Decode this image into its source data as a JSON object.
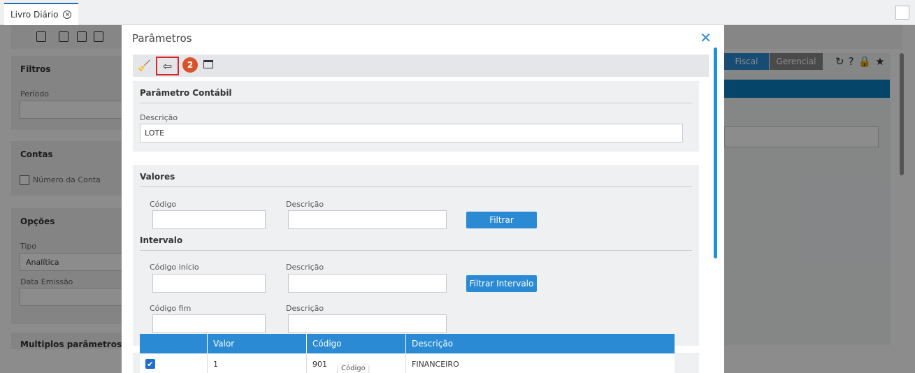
{
  "tab": {
    "label": "Livro Diário"
  },
  "background": {
    "filtros": {
      "title": "Filtros",
      "periodo_label": "Período"
    },
    "contas": {
      "title": "Contas",
      "numero_conta_label": "Número da Conta"
    },
    "opcoes": {
      "title": "Opções",
      "tipo_label": "Tipo",
      "tipo_value": "Analítica",
      "data_emissao_label": "Data Emissão"
    },
    "multiplos": {
      "title": "Multiplos parâmetros"
    },
    "buttons": {
      "fiscal": "Fiscal",
      "gerencial": "Gerencial"
    }
  },
  "modal": {
    "title": "Parâmetros",
    "close": "✕",
    "toolbar": {
      "broom_glyph": "🧹",
      "back_glyph": "⇦",
      "badge": "2"
    },
    "parametro_contabil": {
      "title": "Parâmetro Contábil",
      "descricao_label": "Descrição",
      "descricao_value": "LOTE"
    },
    "valores": {
      "title": "Valores",
      "codigo_label": "Código",
      "descricao_label": "Descrição",
      "filtrar_button": "Filtrar"
    },
    "intervalo": {
      "title": "Intervalo",
      "codigo_inicio_label": "Código início",
      "descricao_label": "Descrição",
      "filtrar_intervalo_button": "Filtrar Intervalo",
      "codigo_fim_label": "Código fim",
      "descricao2_label": "Descrição"
    },
    "grid": {
      "headers": [
        "",
        "Valor",
        "Código",
        "Descrição"
      ],
      "rows": [
        {
          "checked": "✔",
          "valor": "1",
          "codigo": "901",
          "descricao": "FINANCEIRO"
        }
      ],
      "tooltip": "Código"
    }
  }
}
